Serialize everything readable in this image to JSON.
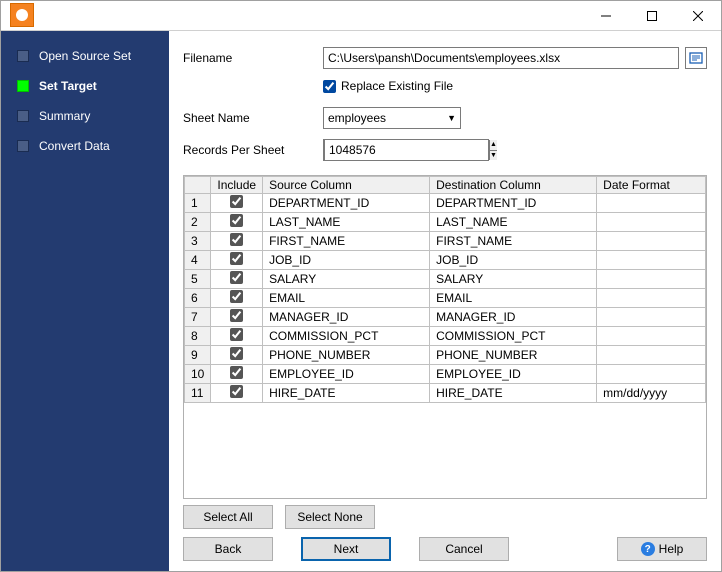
{
  "sidebar": {
    "steps": [
      {
        "label": "Open Source Set",
        "active": false
      },
      {
        "label": "Set Target",
        "active": true
      },
      {
        "label": "Summary",
        "active": false
      },
      {
        "label": "Convert Data",
        "active": false
      }
    ]
  },
  "form": {
    "filename_label": "Filename",
    "filename_value": "C:\\Users\\pansh\\Documents\\employees.xlsx",
    "replace_label": "Replace Existing File",
    "replace_checked": true,
    "sheetname_label": "Sheet Name",
    "sheetname_value": "employees",
    "records_label": "Records Per Sheet",
    "records_value": "1048576"
  },
  "grid": {
    "headers": {
      "include": "Include",
      "source": "Source Column",
      "dest": "Destination Column",
      "datefmt": "Date Format"
    },
    "rows": [
      {
        "n": "1",
        "inc": true,
        "src": "DEPARTMENT_ID",
        "dst": "DEPARTMENT_ID",
        "fmt": ""
      },
      {
        "n": "2",
        "inc": true,
        "src": "LAST_NAME",
        "dst": "LAST_NAME",
        "fmt": ""
      },
      {
        "n": "3",
        "inc": true,
        "src": "FIRST_NAME",
        "dst": "FIRST_NAME",
        "fmt": ""
      },
      {
        "n": "4",
        "inc": true,
        "src": "JOB_ID",
        "dst": "JOB_ID",
        "fmt": ""
      },
      {
        "n": "5",
        "inc": true,
        "src": "SALARY",
        "dst": "SALARY",
        "fmt": ""
      },
      {
        "n": "6",
        "inc": true,
        "src": "EMAIL",
        "dst": "EMAIL",
        "fmt": ""
      },
      {
        "n": "7",
        "inc": true,
        "src": "MANAGER_ID",
        "dst": "MANAGER_ID",
        "fmt": ""
      },
      {
        "n": "8",
        "inc": true,
        "src": "COMMISSION_PCT",
        "dst": "COMMISSION_PCT",
        "fmt": ""
      },
      {
        "n": "9",
        "inc": true,
        "src": "PHONE_NUMBER",
        "dst": "PHONE_NUMBER",
        "fmt": ""
      },
      {
        "n": "10",
        "inc": true,
        "src": "EMPLOYEE_ID",
        "dst": "EMPLOYEE_ID",
        "fmt": ""
      },
      {
        "n": "11",
        "inc": true,
        "src": "HIRE_DATE",
        "dst": "HIRE_DATE",
        "fmt": "mm/dd/yyyy"
      }
    ]
  },
  "buttons": {
    "select_all": "Select All",
    "select_none": "Select None",
    "back": "Back",
    "next": "Next",
    "cancel": "Cancel",
    "help": "Help"
  }
}
